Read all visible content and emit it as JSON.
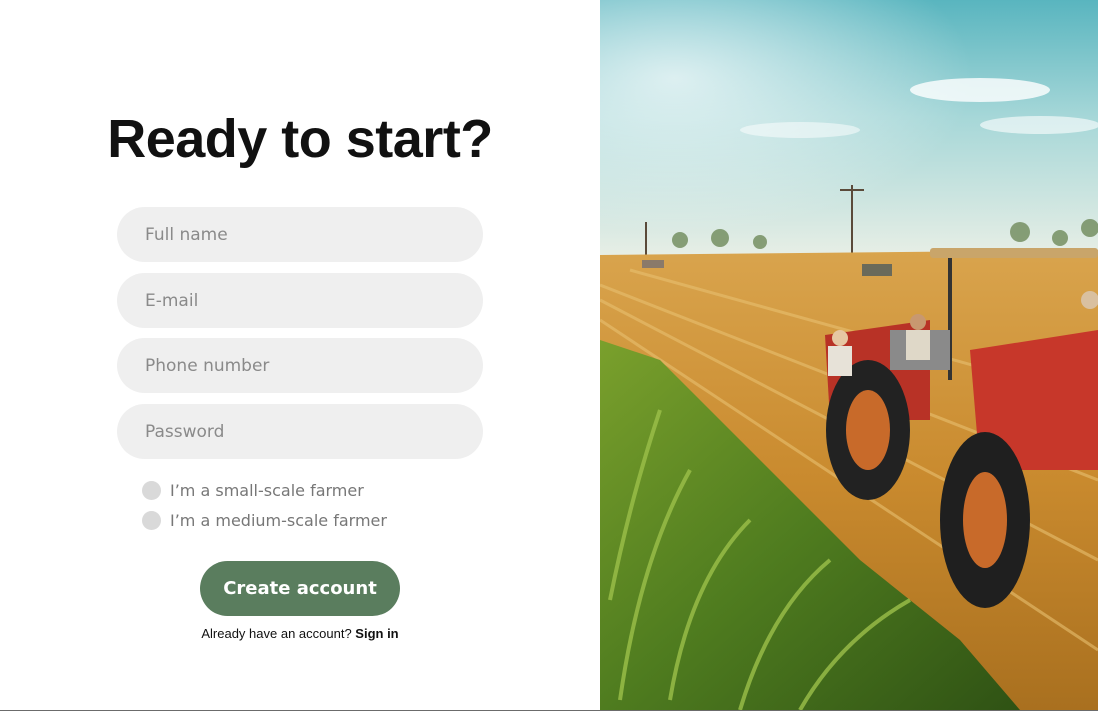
{
  "heading": "Ready to start?",
  "form": {
    "full_name": {
      "placeholder": "Full name",
      "value": ""
    },
    "email": {
      "placeholder": "E-mail",
      "value": ""
    },
    "phone": {
      "placeholder": "Phone number",
      "value": ""
    },
    "password": {
      "placeholder": "Password",
      "value": ""
    }
  },
  "farmer_options": [
    {
      "label": "I’m a small-scale farmer"
    },
    {
      "label": "I’m a medium-scale farmer"
    }
  ],
  "create_button_label": "Create account",
  "signin": {
    "prompt": "Already have an account?",
    "link_label": "Sign in"
  },
  "colors": {
    "accent_button": "#5a7d5e",
    "input_background": "#efefef",
    "radio_fill": "#d9d9d9"
  },
  "hero_image": {
    "subject": "tractor-in-corn-field-photo"
  }
}
